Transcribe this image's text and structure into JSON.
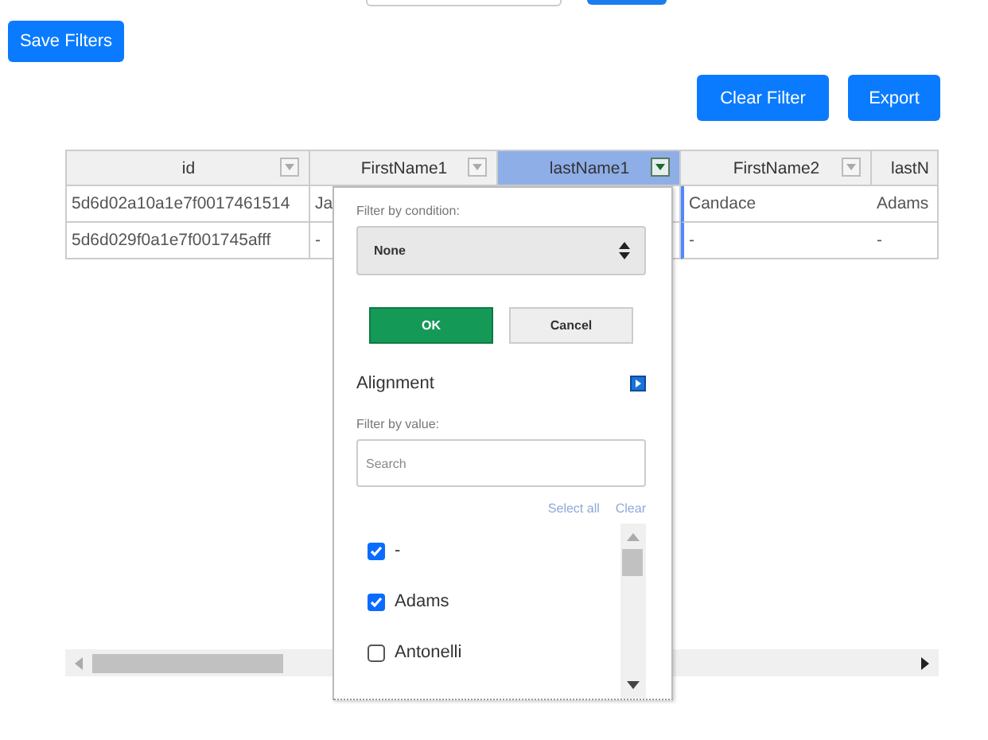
{
  "buttons": {
    "save": "Save Filters",
    "clear": "Clear Filter",
    "export": "Export"
  },
  "table": {
    "columns": [
      {
        "label": "id",
        "selected": false
      },
      {
        "label": "FirstName1",
        "selected": false
      },
      {
        "label": "lastName1",
        "selected": true
      },
      {
        "label": "FirstName2",
        "selected": false
      },
      {
        "label": "lastN",
        "selected": false
      }
    ],
    "rows": [
      {
        "cells": [
          "5d6d02a10a1e7f0017461514",
          "Ja",
          "",
          "Candace",
          "Adams"
        ]
      },
      {
        "cells": [
          "5d6d029f0a1e7f001745afff",
          "-",
          "",
          "-",
          "-"
        ]
      }
    ]
  },
  "filter_menu": {
    "condition_label": "Filter by condition:",
    "condition": "None",
    "ok": "OK",
    "cancel": "Cancel",
    "alignment": "Alignment",
    "value_label": "Filter by value:",
    "search": {
      "placeholder": "Search"
    },
    "select_all": "Select all",
    "clear": "Clear",
    "values": [
      {
        "label": "-",
        "checked": true
      },
      {
        "label": "Adams",
        "checked": true
      },
      {
        "label": "Antonelli",
        "checked": false
      }
    ]
  }
}
